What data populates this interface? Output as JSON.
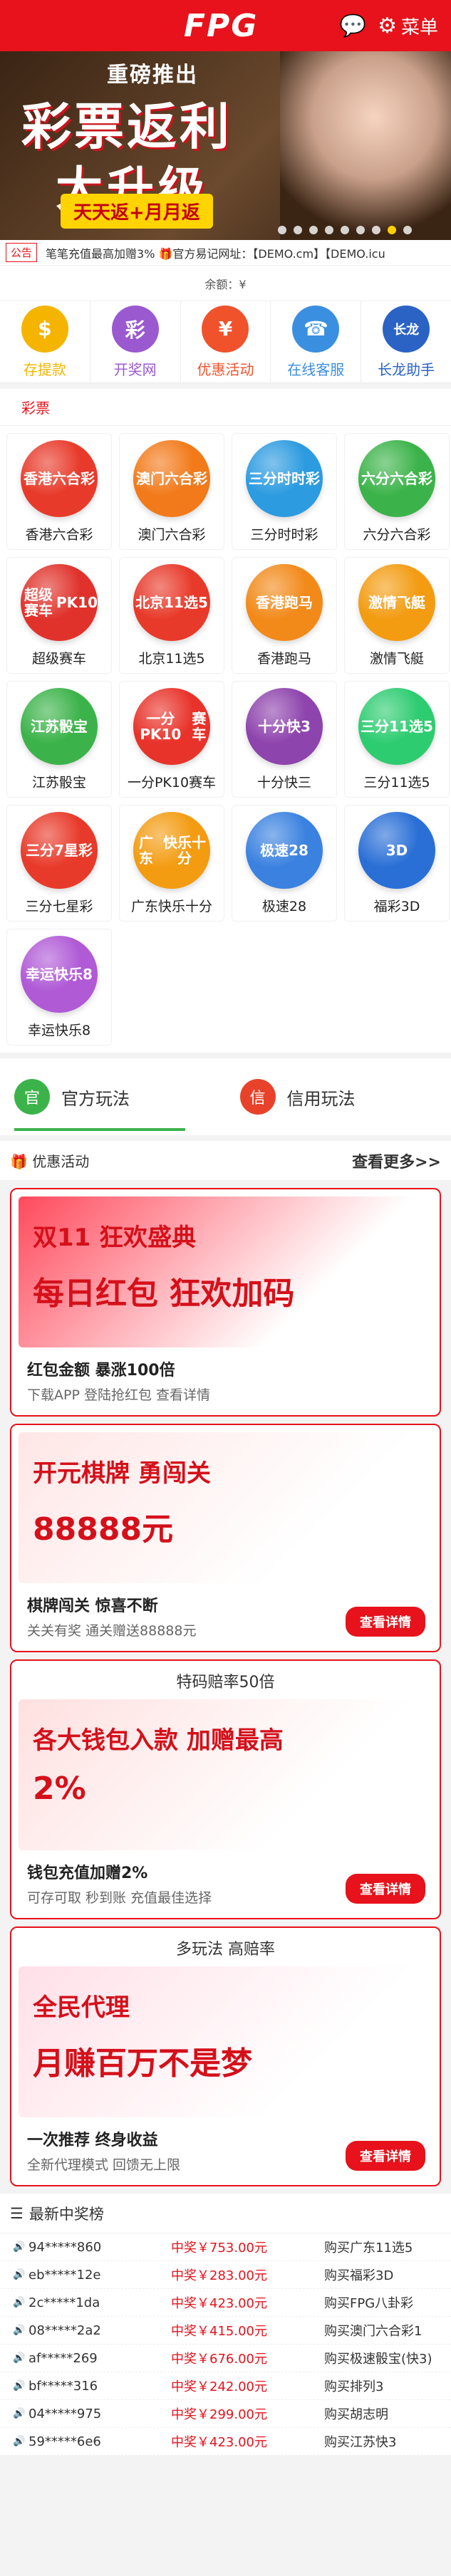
{
  "header": {
    "logo": "FPG",
    "menu_label": "菜单"
  },
  "banner": {
    "line1": "重磅推出",
    "line2": "彩票返利",
    "line3": "大升级",
    "tag": "天天返+月月返",
    "dots": 9,
    "active_dot": 7
  },
  "notice": {
    "label": "公告",
    "text": "笔笔充值最高加赠3% 🎁官方易记网址：【DEMO.cm】【DEMO.icu"
  },
  "balance": {
    "text": "余额：¥"
  },
  "quick": [
    {
      "label": "存提款",
      "icon": "wallet-icon",
      "color": "#f4b400",
      "glyph": "$"
    },
    {
      "label": "开奖网",
      "icon": "lottery-icon",
      "color": "#9b59d0",
      "glyph": "彩"
    },
    {
      "label": "优惠活动",
      "icon": "gift-icon",
      "color": "#f0522b",
      "glyph": "¥"
    },
    {
      "label": "在线客服",
      "icon": "support-icon",
      "color": "#3b8fe0",
      "glyph": "☎"
    },
    {
      "label": "长龙助手",
      "icon": "dragon-icon",
      "color": "#2a63c4",
      "glyph": "长龙"
    }
  ],
  "lottery_section": {
    "title": "彩票"
  },
  "games": [
    {
      "name": "香港六合彩",
      "ball_text": "香港\n六合彩",
      "color": "#e83a2a"
    },
    {
      "name": "澳门六合彩",
      "ball_text": "澳门\n六合彩",
      "color": "#f27a1a"
    },
    {
      "name": "三分时时彩",
      "ball_text": "三分\n时时彩",
      "color": "#2c9be0"
    },
    {
      "name": "六分六合彩",
      "ball_text": "六分\n六合彩",
      "color": "#3cb34a"
    },
    {
      "name": "超级赛车",
      "ball_text": "超级赛车\nPK10",
      "color": "#e0322b"
    },
    {
      "name": "北京11选5",
      "ball_text": "北京\n11选5",
      "color": "#e83a2a"
    },
    {
      "name": "香港跑马",
      "ball_text": "香港跑马",
      "color": "#f28a1a"
    },
    {
      "name": "激情飞艇",
      "ball_text": "激情飞艇",
      "color": "#f39c12"
    },
    {
      "name": "江苏骰宝",
      "ball_text": "江苏骰宝",
      "color": "#3cb34a"
    },
    {
      "name": "一分PK10赛车",
      "ball_text": "一分PK10\n赛车",
      "color": "#e8332a"
    },
    {
      "name": "十分快三",
      "ball_text": "十分\n快3",
      "color": "#8e44ad"
    },
    {
      "name": "三分11选5",
      "ball_text": "三分\n11选5",
      "color": "#2ecc71"
    },
    {
      "name": "三分七星彩",
      "ball_text": "三分\n7星彩",
      "color": "#e83a2a"
    },
    {
      "name": "广东快乐十分",
      "ball_text": "广东\n快乐十分",
      "color": "#f39c12"
    },
    {
      "name": "极速28",
      "ball_text": "极速28",
      "color": "#3b82e0"
    },
    {
      "name": "福彩3D",
      "ball_text": "3D",
      "color": "#2a6fd6"
    },
    {
      "name": "幸运快乐8",
      "ball_text": "幸运\n快乐8",
      "color": "#b05ad6"
    }
  ],
  "play": [
    {
      "label": "官方玩法",
      "icon": "official-icon",
      "color": "#3cb34a",
      "glyph": "官"
    },
    {
      "label": "信用玩法",
      "icon": "credit-icon",
      "color": "#e8432a",
      "glyph": "信"
    }
  ],
  "promo": {
    "title": "优惠活动",
    "more": "查看更多>>"
  },
  "cards": [
    {
      "head": "",
      "img_line1": "双11 狂欢盛典",
      "img_line2": "每日红包 狂欢加码",
      "bg": "#ff4a5c",
      "caption": "红包金额  暴涨100倍",
      "sub": "下载APP  登陆抢红包  查看详情",
      "button": ""
    },
    {
      "head": "",
      "img_line1": "开元棋牌 勇闯关",
      "img_line2": "88888元",
      "bg": "#ffe6e6",
      "caption": "棋牌闯关  惊喜不断",
      "sub": "关关有奖  通关赠送88888元",
      "button": "查看详情"
    },
    {
      "head": "特码赔率50倍",
      "img_line1": "各大钱包入款 加赠最高",
      "img_line2": "2%",
      "bg": "#ffe0e0",
      "caption": "钱包充值加赠2%",
      "sub": "可存可取  秒到账  充值最佳选择",
      "button": "查看详情"
    },
    {
      "head": "多玩法 高赔率",
      "img_line1": "全民代理",
      "img_line2": "月赚百万不是梦",
      "bg": "#ffe0e8",
      "caption": "一次推荐  终身收益",
      "sub": "全新代理模式  回馈无上限",
      "button": "查看详情"
    }
  ],
  "winners": {
    "title": "最新中奖榜",
    "rows": [
      {
        "user": "94*****860",
        "money": "中奖￥753.00元",
        "game": "购买广东11选5"
      },
      {
        "user": "eb*****12e",
        "money": "中奖￥283.00元",
        "game": "购买福彩3D"
      },
      {
        "user": "2c*****1da",
        "money": "中奖￥423.00元",
        "game": "购买FPG八卦彩"
      },
      {
        "user": "08*****2a2",
        "money": "中奖￥415.00元",
        "game": "购买澳门六合彩1"
      },
      {
        "user": "af*****269",
        "money": "中奖￥676.00元",
        "game": "购买极速骰宝(快3)"
      },
      {
        "user": "bf*****316",
        "money": "中奖￥242.00元",
        "game": "购买排列3"
      },
      {
        "user": "04*****975",
        "money": "中奖￥299.00元",
        "game": "购买胡志明"
      },
      {
        "user": "59*****6e6",
        "money": "中奖￥423.00元",
        "game": "购买江苏快3"
      }
    ]
  }
}
